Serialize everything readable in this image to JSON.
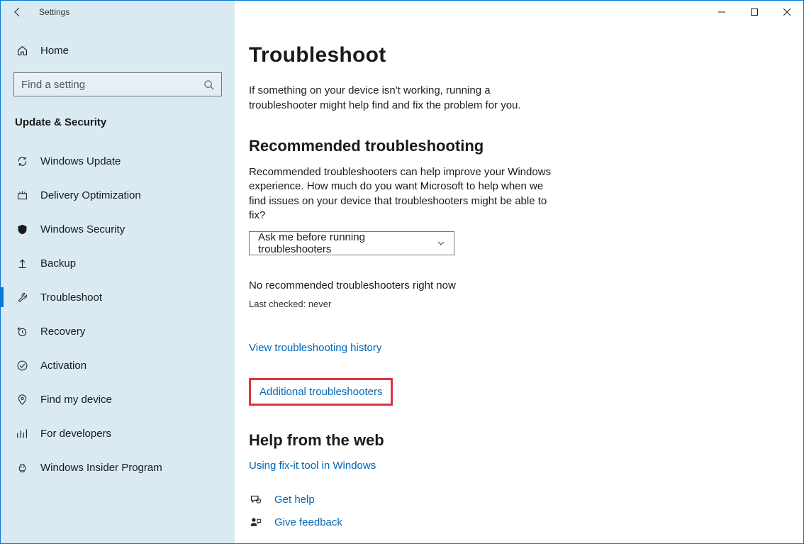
{
  "window": {
    "app_title": "Settings"
  },
  "sidebar": {
    "home_label": "Home",
    "search_placeholder": "Find a setting",
    "category": "Update & Security",
    "items": [
      {
        "label": "Windows Update",
        "icon": "sync-icon"
      },
      {
        "label": "Delivery Optimization",
        "icon": "delivery-icon"
      },
      {
        "label": "Windows Security",
        "icon": "shield-icon"
      },
      {
        "label": "Backup",
        "icon": "backup-icon"
      },
      {
        "label": "Troubleshoot",
        "icon": "wrench-icon",
        "selected": true
      },
      {
        "label": "Recovery",
        "icon": "recovery-icon"
      },
      {
        "label": "Activation",
        "icon": "check-circle-icon"
      },
      {
        "label": "Find my device",
        "icon": "location-icon"
      },
      {
        "label": "For developers",
        "icon": "dev-icon"
      },
      {
        "label": "Windows Insider Program",
        "icon": "bug-icon"
      }
    ]
  },
  "main": {
    "title": "Troubleshoot",
    "intro": "If something on your device isn't working, running a troubleshooter might help find and fix the problem for you.",
    "recommended": {
      "heading": "Recommended troubleshooting",
      "desc": "Recommended troubleshooters can help improve your Windows experience. How much do you want Microsoft to help when we find issues on your device that troubleshooters might be able to fix?",
      "dropdown_value": "Ask me before running troubleshooters",
      "status": "No recommended troubleshooters right now",
      "last_checked": "Last checked: never",
      "history_link": "View troubleshooting history"
    },
    "additional_link": "Additional troubleshooters",
    "help": {
      "heading": "Help from the web",
      "fixit_link": "Using fix-it tool in Windows",
      "get_help": "Get help",
      "give_feedback": "Give feedback"
    }
  }
}
